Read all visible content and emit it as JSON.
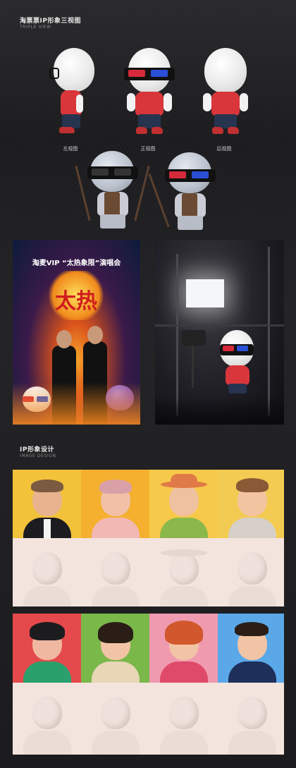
{
  "section1": {
    "title": "淘票票IP形象三视图",
    "subtitle": "TRIPLE VIEW"
  },
  "views": {
    "left": "左视图",
    "front": "正视图",
    "back": "后视图"
  },
  "poster": {
    "title": "淘麦VIP “太热象限”演唱会",
    "logo_text": "太热"
  },
  "section2": {
    "title": "IP形象设计",
    "subtitle": "IMAGE DESIGN"
  },
  "colors": {
    "accent_red": "#d9363b",
    "lens_red": "#d62a3a",
    "lens_blue": "#2a4fd6",
    "pants": "#26344f"
  }
}
